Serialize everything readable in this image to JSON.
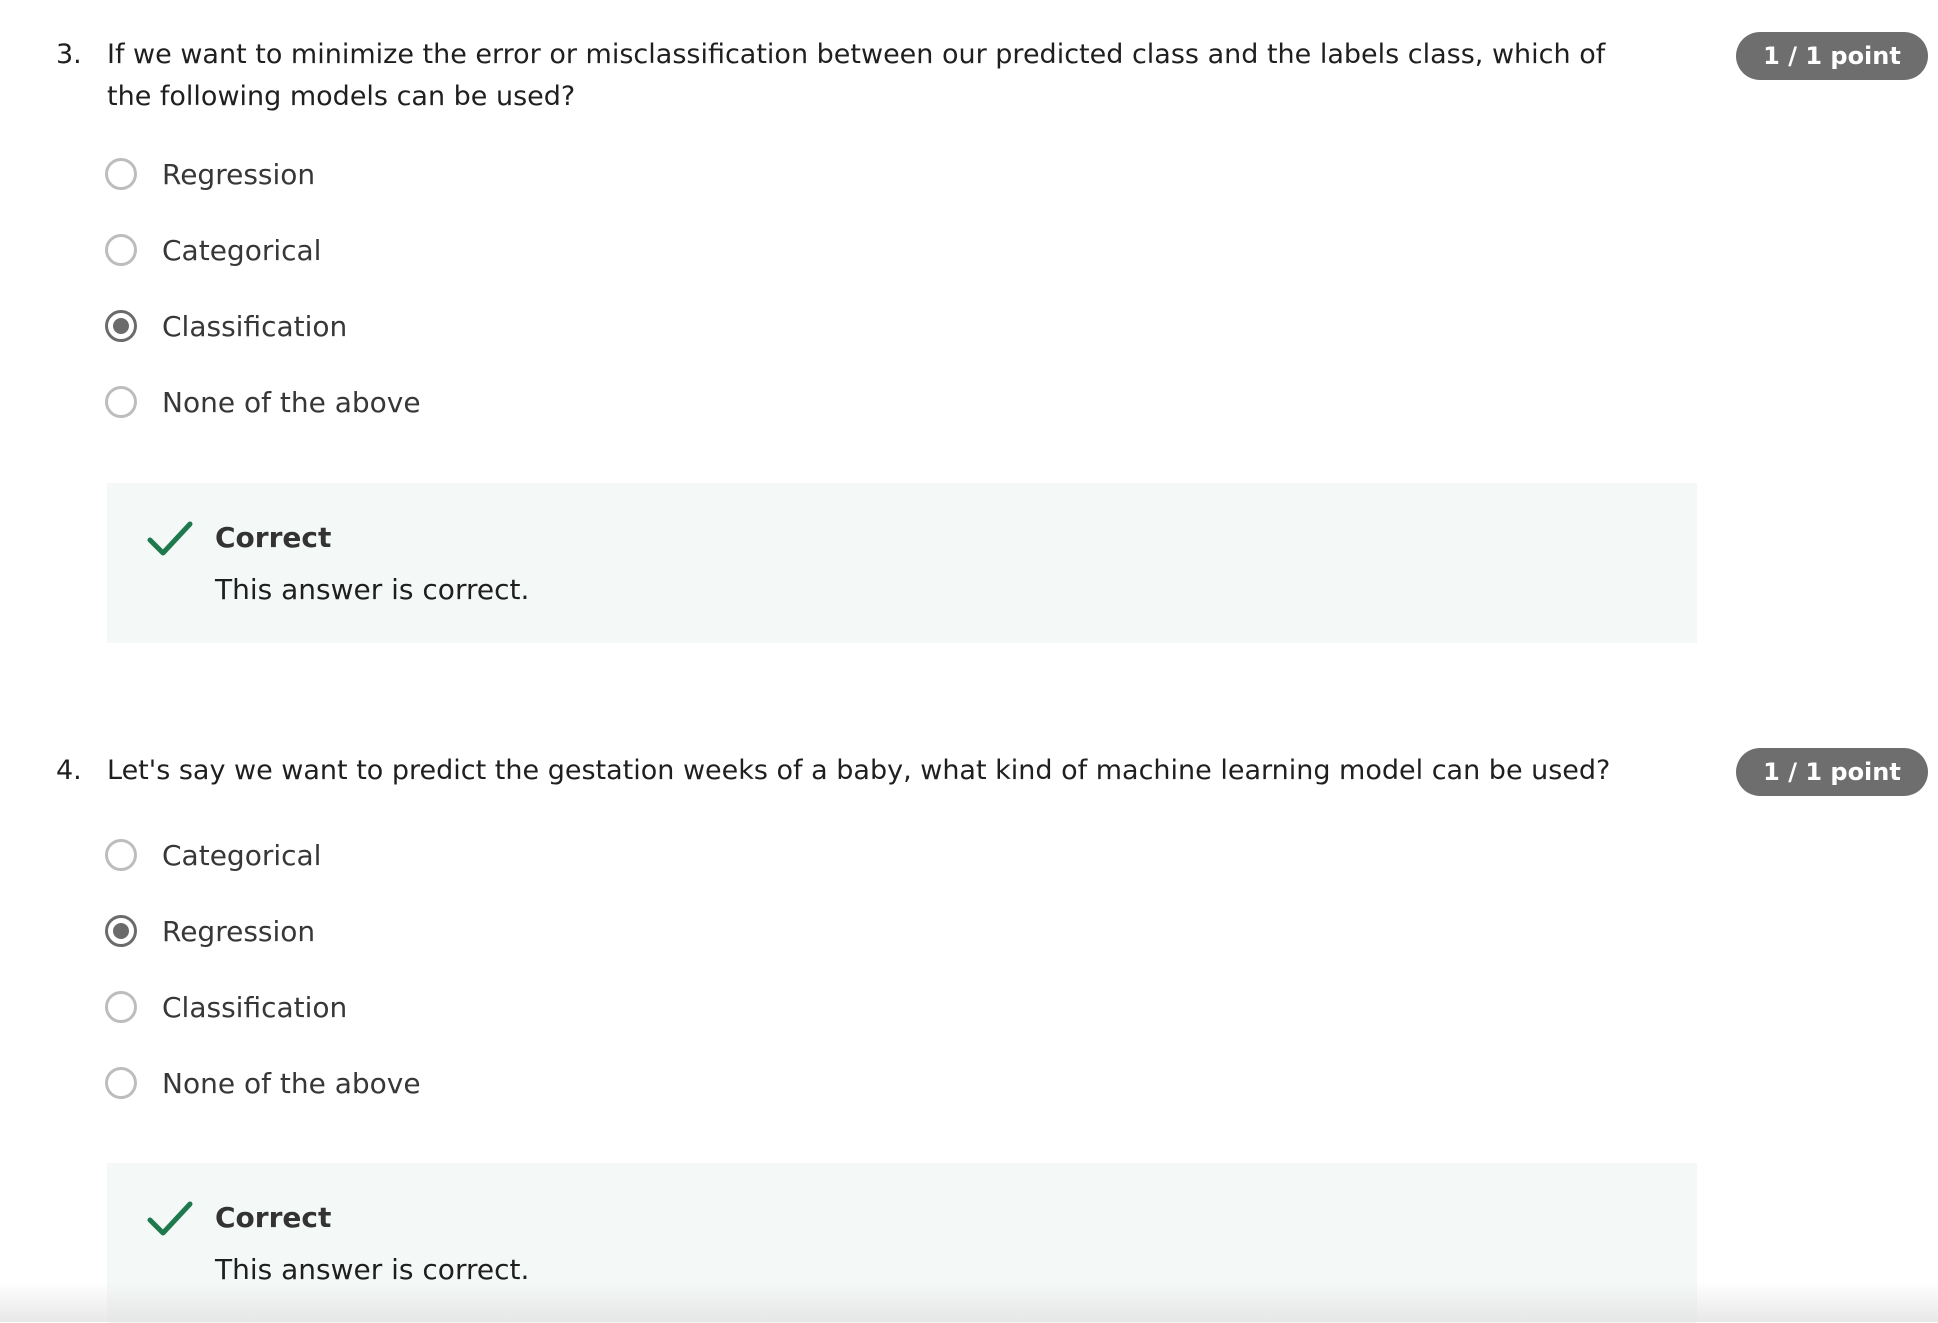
{
  "questions": [
    {
      "number": "3.",
      "text": "If we want to minimize the error or misclassification between our predicted class and the labels class, which of the following models can be used?",
      "points": "1 / 1 point",
      "options": [
        {
          "label": "Regression",
          "selected": false
        },
        {
          "label": "Categorical",
          "selected": false
        },
        {
          "label": "Classification",
          "selected": true
        },
        {
          "label": "None of the above",
          "selected": false
        }
      ],
      "feedback": {
        "title": "Correct",
        "text": "This answer is correct.",
        "icon": "checkmark-icon",
        "color": "#1e7a4c"
      }
    },
    {
      "number": "4.",
      "text": "Let's say we want to predict the gestation weeks of a baby, what kind of machine learning model can be used?",
      "points": "1 / 1 point",
      "options": [
        {
          "label": "Categorical",
          "selected": false
        },
        {
          "label": "Regression",
          "selected": true
        },
        {
          "label": "Classification",
          "selected": false
        },
        {
          "label": "None of the above",
          "selected": false
        }
      ],
      "feedback": {
        "title": "Correct",
        "text": "This answer is correct.",
        "icon": "checkmark-icon",
        "color": "#1e7a4c"
      }
    }
  ],
  "colors": {
    "badge_bg": "#6e6e6e",
    "feedback_bg": "#f4f8f7",
    "check_green": "#1e7a4c",
    "radio_selected": "#6b6b6b",
    "radio_unselected": "#bdbdbd"
  }
}
